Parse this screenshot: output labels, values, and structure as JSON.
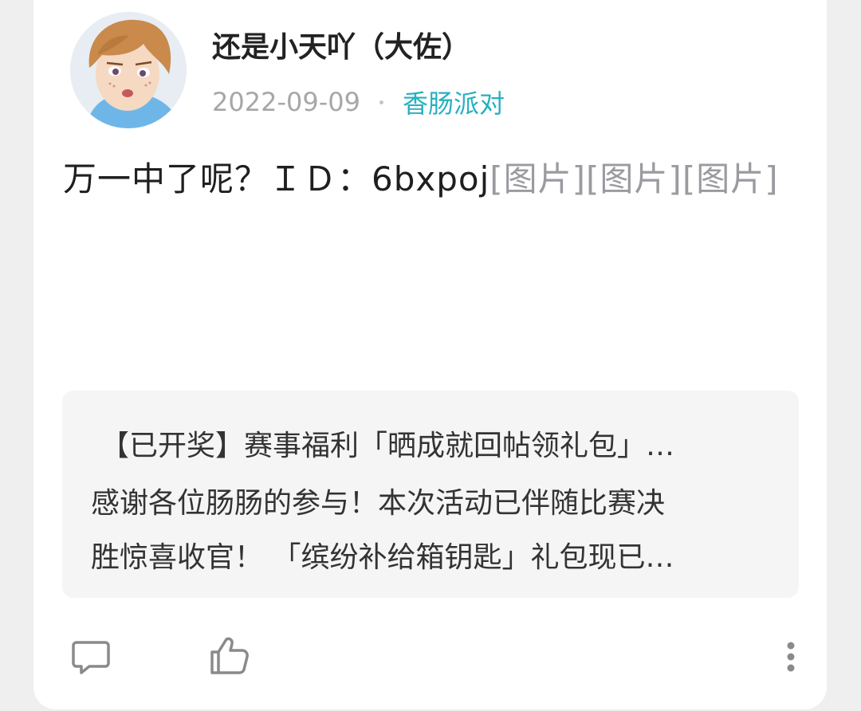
{
  "post": {
    "author": "还是小天吖（大佐）",
    "date": "2022-09-09",
    "channel": "香肠派对",
    "text": "万一中了呢？ＩＤ：6bxpoj",
    "image_tags": [
      "[图片]",
      "[图片]",
      "[图片]"
    ]
  },
  "quote": {
    "title": "【已开奖】赛事福利「晒成就回帖领礼包」…",
    "line1": "感谢各位肠肠的参与！本次活动已伴随比赛决",
    "line2": "胜惊喜收官！ 「缤纷补给箱钥匙」礼包现已…"
  },
  "actions": {
    "comment_icon": "comment-icon",
    "like_icon": "thumbs-up-icon",
    "more_icon": "more-vertical-icon"
  },
  "colors": {
    "channel": "#27b0bf",
    "image_tag": "#9a9aa0",
    "quote_bg": "#f5f5f5"
  }
}
